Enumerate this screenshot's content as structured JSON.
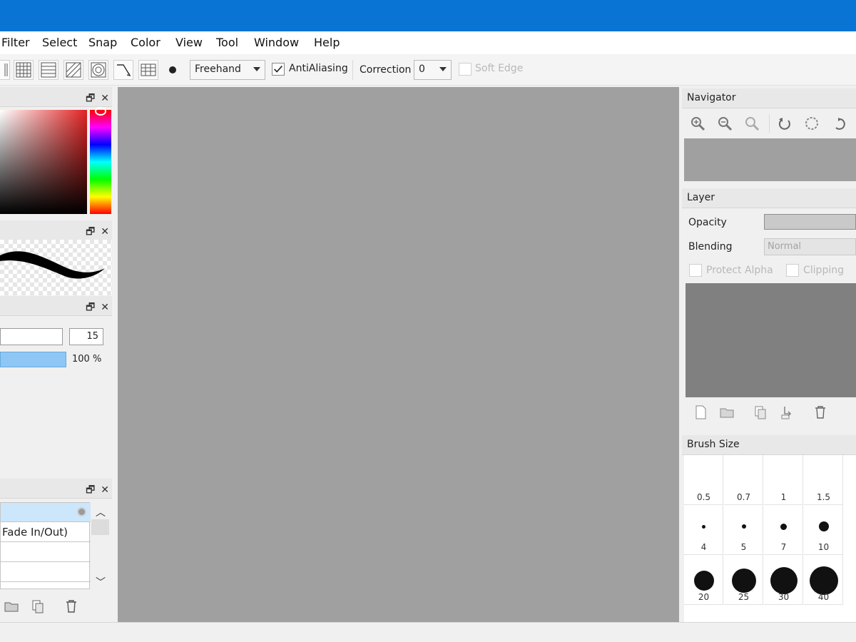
{
  "menu": [
    "Filter",
    "Select",
    "Snap",
    "Color",
    "View",
    "Tool",
    "Window",
    "Help"
  ],
  "toolbar": {
    "curve_mode": "Freehand",
    "antialiasing_label": "AntiAliasing",
    "antialiasing_checked": true,
    "correction_label": "Correction",
    "correction_value": "0",
    "soft_edge_label": "Soft Edge",
    "soft_edge_checked": false
  },
  "panel_buttons": {
    "float": "🗗",
    "close": "✕"
  },
  "brush_control": {
    "size_value": "15",
    "density_label": "100 %",
    "density_fraction": 1.0
  },
  "brush_list": {
    "items": [
      "",
      "Fade In/Out)",
      "",
      ""
    ]
  },
  "navigator": {
    "title": "Navigator"
  },
  "layer": {
    "title": "Layer",
    "opacity_label": "Opacity",
    "blending_label": "Blending",
    "blending_value": "Normal",
    "protect_alpha_label": "Protect Alpha",
    "clipping_label": "Clipping"
  },
  "brush_size": {
    "title": "Brush Size",
    "cells": [
      {
        "label": "0.5",
        "size": 0
      },
      {
        "label": "0.7",
        "size": 0
      },
      {
        "label": "1",
        "size": 0
      },
      {
        "label": "1.5",
        "size": 0
      },
      {
        "label": "4",
        "size": 5
      },
      {
        "label": "5",
        "size": 6
      },
      {
        "label": "7",
        "size": 9
      },
      {
        "label": "10",
        "size": 14
      },
      {
        "label": "20",
        "size": 28
      },
      {
        "label": "25",
        "size": 34
      },
      {
        "label": "30",
        "size": 38
      },
      {
        "label": "40",
        "size": 40
      }
    ]
  },
  "colors": {
    "titlebar": "#0a74d4",
    "canvas": "#a0a0a0",
    "accent": "#8ec7f5"
  }
}
